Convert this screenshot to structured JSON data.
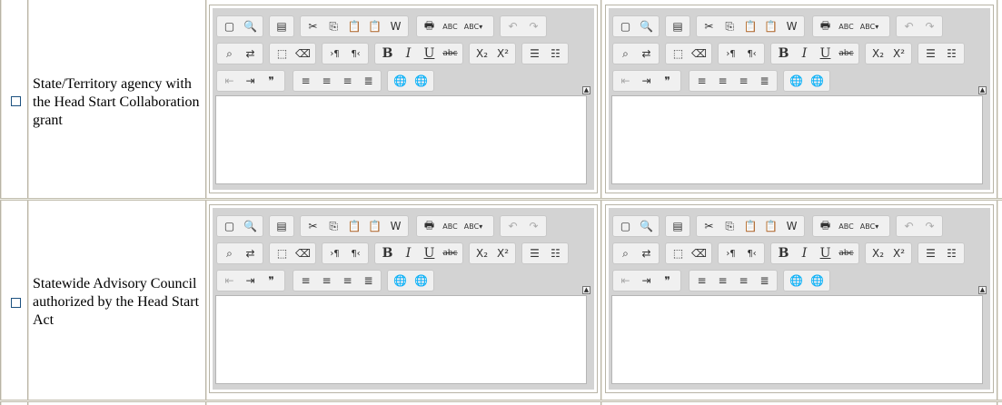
{
  "rows": [
    {
      "label": "State/Territory agency with the Head Start Collaboration grant"
    },
    {
      "label": "Statewide Advisory Council authorized by the Head Start Act"
    }
  ],
  "toolbar": {
    "row1": [
      "new-page",
      "preview",
      "templates",
      "cut",
      "copy",
      "paste",
      "paste-text",
      "paste-word",
      "print",
      "spellcheck",
      "scayt",
      "undo",
      "redo"
    ],
    "row2": [
      "find",
      "replace",
      "select-all",
      "remove-format",
      "ltr",
      "rtl",
      "bold",
      "italic",
      "underline",
      "strike",
      "subscript",
      "superscript",
      "numbered-list",
      "bulleted-list"
    ],
    "row3": [
      "outdent",
      "indent",
      "blockquote",
      "align-left",
      "align-center",
      "align-right",
      "justify",
      "link",
      "unlink"
    ],
    "labels": {
      "bold": "B",
      "italic": "I",
      "underline": "U",
      "strike": "abc",
      "subscript": "X₂",
      "superscript": "X²",
      "blockquote": "❞",
      "collapse": "▲"
    }
  }
}
